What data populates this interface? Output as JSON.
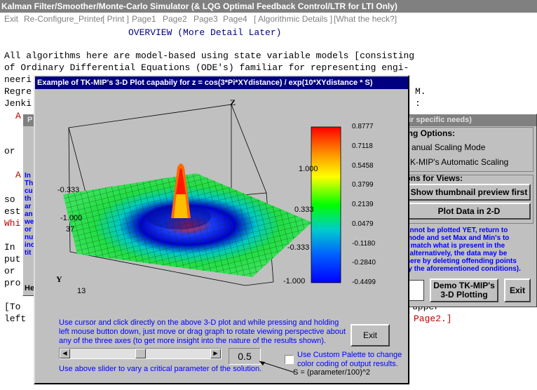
{
  "app": {
    "title": "Kalman Filter/Smoother/Monte-Carlo Simulator (& LQG Optimal Feedback Control/LTR for LTI Only)",
    "menu": [
      "Exit",
      "Re-Configure_Printer",
      "[ Print ]",
      "Page1",
      "Page2",
      "Page3",
      "Page4",
      "[ Algorithmic Details ]",
      "[What the heck?]"
    ]
  },
  "doc": {
    "heading": "OVERVIEW (More Detail Later)",
    "lines": [
      "All algorithms here are model-based using state variable models [consisting",
      "of Ordinary Differential Equations (ODE's) familiar for representing engi-",
      "neeri",
      "Regre",
      "Jenki"
    ],
    "right_M": "M.",
    "right_colon": ":",
    "left_frags": [
      "A",
      "or",
      "A",
      "so",
      "est",
      "Whi",
      "In",
      "put",
      "or",
      "pro",
      "[To",
      "left"
    ],
    "right_tail_1": "upper",
    "right_tail_2": "Page2.]"
  },
  "options_dialog": {
    "title": "ir specific needs)",
    "scaling_group": "ling Options:",
    "manual_scaling": "anual Scaling Mode",
    "auto_scaling": "K-MIP's Automatic Scaling",
    "views_group": "ions for Views:",
    "thumbnail_button": "Show thumbnail preview first",
    "plot2d_button": "Plot Data in 2-D",
    "warning_lines": [
      "annot be plotted YET, return to",
      " mode and set Max and Min's to",
      "r match what is present in the",
      ", alternatively, the data may be",
      "here by deleting offending points",
      "fy the aforementioned conditions)."
    ],
    "demo_button_l1": "Demo TK-MIP's",
    "demo_button_l2": "3-D Plotting",
    "exit_button": "Exit"
  },
  "behind_dialog": {
    "title_char": "P",
    "blue_lines": [
      "In",
      "Th",
      "cu",
      "th",
      "ar",
      "an",
      "we",
      "or",
      "nu",
      "inc",
      "tit"
    ],
    "bottom_label": "He"
  },
  "plot_dialog": {
    "title": "Example of TK-MIP's 3-D Plot capabily for z = cos(3*Pi*XYdistance) / exp(10*XYdistance * S)",
    "axis_z": "Z",
    "axis_y": "Y",
    "tick_left_1": "-0.333",
    "tick_left_2": "-1.000",
    "tick_left_3": "37",
    "tick_left_4": "13",
    "tick_right_1": "1.000",
    "tick_right_2": "0.333",
    "tick_right_3": "-0.333",
    "tick_right_4": "-1.000",
    "colorbar_labels": [
      "0.8777",
      "0.7118",
      "0.5458",
      "0.3799",
      "0.2139",
      "0.0479",
      "-0.1180",
      "-0.2840",
      "-0.4499"
    ],
    "instructions": "Use cursor and click directly on the above 3-D plot and while pressing and holding left mouse button down, just move or drag graph to rotate viewing perspective about any of the three axes (to get more insight into the nature of the results shown).",
    "slider_hint": "Use above slider to vary a critical parameter of the solution.",
    "slider_level": 0.5,
    "param_value": "0.5",
    "formula": "S = (parameter/100)^2",
    "palette_checkbox": "Use Custom Palette to change color coding of output results.",
    "exit_button": "Exit"
  }
}
